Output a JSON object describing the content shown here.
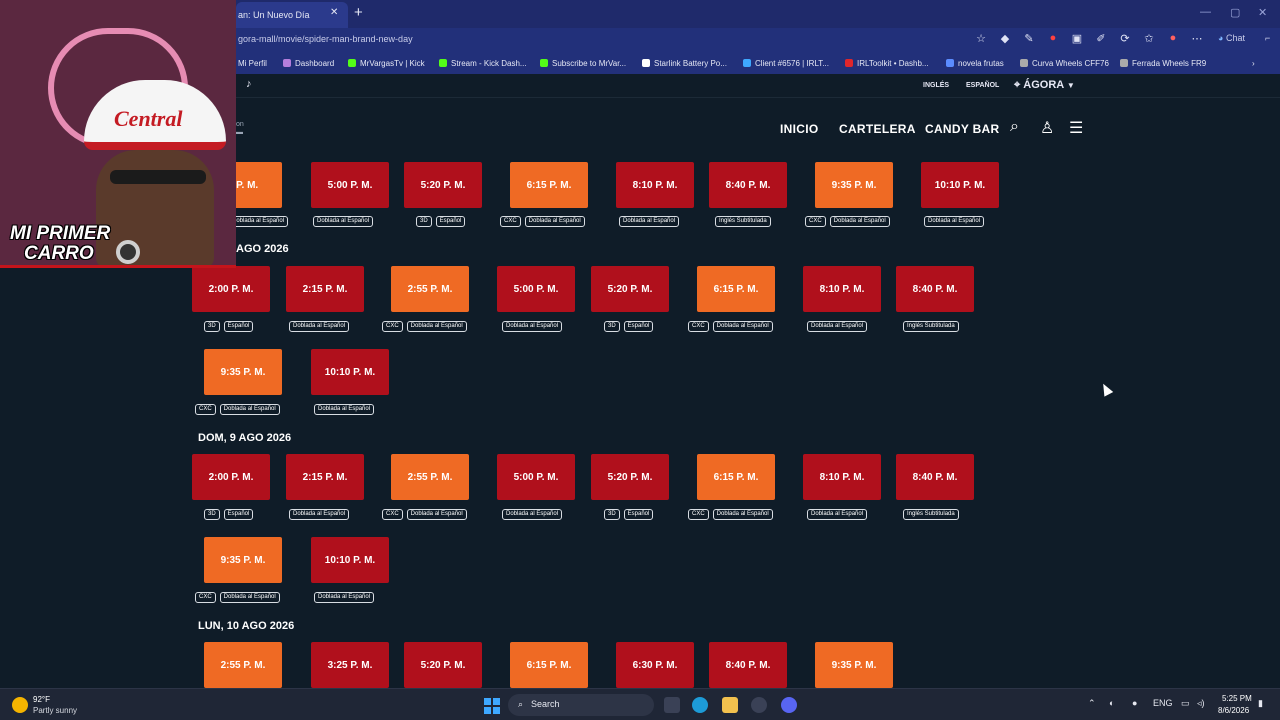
{
  "browser": {
    "tab_title": "an: Un Nuevo Día",
    "url": "gora-mall/movie/spider-man-brand-new-day",
    "chat_label": "Chat",
    "bookmarks": [
      {
        "label": "Mi Perfil",
        "color": "#e0e0e0"
      },
      {
        "label": "Dashboard",
        "color": "#b57edc"
      },
      {
        "label": "MrVargasTv | Kick",
        "color": "#53fc18"
      },
      {
        "label": "Stream - Kick Dash...",
        "color": "#53fc18"
      },
      {
        "label": "Subscribe to MrVar...",
        "color": "#53fc18"
      },
      {
        "label": "Starlink Battery Po...",
        "color": "#ffffff"
      },
      {
        "label": "Client #6576 | IRLT...",
        "color": "#3ea8ff"
      },
      {
        "label": "IRLToolkit • Dashb...",
        "color": "#e0262b"
      },
      {
        "label": "novela frutas",
        "color": "#5b8cff"
      },
      {
        "label": "Curva Wheels CFF76",
        "color": "#aaaaaa"
      },
      {
        "label": "Ferrada Wheels FR9",
        "color": "#aaaaaa"
      }
    ]
  },
  "site": {
    "lang_en": "INGLÉS",
    "lang_es": "ESPAÑOL",
    "location": "ÁGORA",
    "nav": [
      "INICIO",
      "CARTELERA",
      "CANDY BAR"
    ],
    "logo_fragment": "on"
  },
  "schedule": {
    "partial_day": {
      "times": [
        {
          "time": "5 P. M.",
          "style": "orange",
          "tags": [
            "Doblada al Español"
          ]
        },
        {
          "time": "5:00 P. M.",
          "style": "red",
          "tags": [
            "Doblada al Español"
          ]
        },
        {
          "time": "5:20 P. M.",
          "style": "red",
          "tags": [
            "3D",
            "Español"
          ]
        },
        {
          "time": "6:15 P. M.",
          "style": "orange",
          "tags": [
            "CXC",
            "Doblada al Español"
          ]
        },
        {
          "time": "8:10 P. M.",
          "style": "red",
          "tags": [
            "Doblada al Español"
          ]
        },
        {
          "time": "8:40 P. M.",
          "style": "red",
          "tags": [
            "Inglés Subtitulada"
          ]
        },
        {
          "time": "9:35 P. M.",
          "style": "orange",
          "tags": [
            "CXC",
            "Doblada al Español"
          ]
        },
        {
          "time": "10:10 P. M.",
          "style": "red",
          "tags": [
            "Doblada al Español"
          ]
        }
      ]
    },
    "day_sab": {
      "label": "AGO 2026",
      "times": [
        {
          "time": "2:00 P. M.",
          "style": "red",
          "tags": [
            "3D",
            "Español"
          ]
        },
        {
          "time": "2:15 P. M.",
          "style": "red",
          "tags": [
            "Doblada al Español"
          ]
        },
        {
          "time": "2:55 P. M.",
          "style": "orange",
          "tags": [
            "CXC",
            "Doblada al Español"
          ]
        },
        {
          "time": "5:00 P. M.",
          "style": "red",
          "tags": [
            "Doblada al Español"
          ]
        },
        {
          "time": "5:20 P. M.",
          "style": "red",
          "tags": [
            "3D",
            "Español"
          ]
        },
        {
          "time": "6:15 P. M.",
          "style": "orange",
          "tags": [
            "CXC",
            "Doblada al Español"
          ]
        },
        {
          "time": "8:10 P. M.",
          "style": "red",
          "tags": [
            "Doblada al Español"
          ]
        },
        {
          "time": "8:40 P. M.",
          "style": "red",
          "tags": [
            "Inglés Subtitulada"
          ]
        },
        {
          "time": "9:35 P. M.",
          "style": "orange",
          "tags": [
            "CXC",
            "Doblada al Español"
          ]
        },
        {
          "time": "10:10 P. M.",
          "style": "red",
          "tags": [
            "Doblada al Español"
          ]
        }
      ]
    },
    "day_dom": {
      "label": "DOM, 9 AGO 2026",
      "times": [
        {
          "time": "2:00 P. M.",
          "style": "red",
          "tags": [
            "3D",
            "Español"
          ]
        },
        {
          "time": "2:15 P. M.",
          "style": "red",
          "tags": [
            "Doblada al Español"
          ]
        },
        {
          "time": "2:55 P. M.",
          "style": "orange",
          "tags": [
            "CXC",
            "Doblada al Español"
          ]
        },
        {
          "time": "5:00 P. M.",
          "style": "red",
          "tags": [
            "Doblada al Español"
          ]
        },
        {
          "time": "5:20 P. M.",
          "style": "red",
          "tags": [
            "3D",
            "Español"
          ]
        },
        {
          "time": "6:15 P. M.",
          "style": "orange",
          "tags": [
            "CXC",
            "Doblada al Español"
          ]
        },
        {
          "time": "8:10 P. M.",
          "style": "red",
          "tags": [
            "Doblada al Español"
          ]
        },
        {
          "time": "8:40 P. M.",
          "style": "red",
          "tags": [
            "Inglés Subtitulada"
          ]
        },
        {
          "time": "9:35 P. M.",
          "style": "orange",
          "tags": [
            "CXC",
            "Doblada al Español"
          ]
        },
        {
          "time": "10:10 P. M.",
          "style": "red",
          "tags": [
            "Doblada al Español"
          ]
        }
      ]
    },
    "day_lun": {
      "label": "LUN, 10 AGO 2026",
      "times": [
        {
          "time": "2:55 P. M.",
          "style": "orange"
        },
        {
          "time": "3:25 P. M.",
          "style": "red"
        },
        {
          "time": "5:20 P. M.",
          "style": "red"
        },
        {
          "time": "6:15 P. M.",
          "style": "orange"
        },
        {
          "time": "6:30 P. M.",
          "style": "red"
        },
        {
          "time": "8:40 P. M.",
          "style": "red"
        },
        {
          "time": "9:35 P. M.",
          "style": "orange"
        }
      ]
    }
  },
  "webcam": {
    "cap_text": "Central",
    "overlay_text_1": "MI PRIMER",
    "overlay_text_2": "CARRO"
  },
  "taskbar": {
    "weather_temp": "92°F",
    "weather_desc": "Partly sunny",
    "search_label": "Search",
    "lang": "ENG",
    "time": "5:25 PM",
    "date": "8/6/2026"
  },
  "colors": {
    "showtime_red": "#b0101c",
    "showtime_orange": "#ef6a24",
    "page_bg": "#0f1c28"
  }
}
